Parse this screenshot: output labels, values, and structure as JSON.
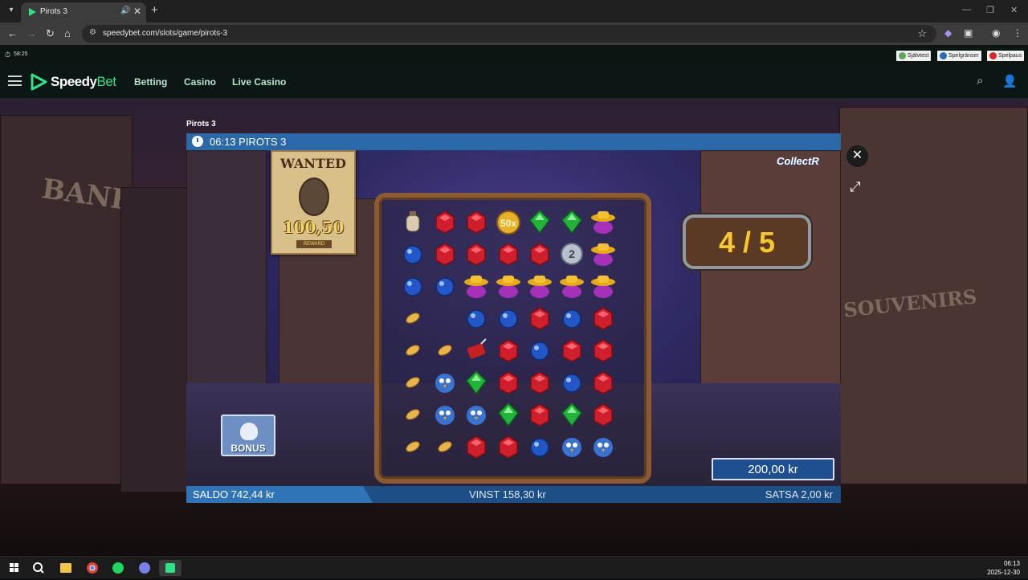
{
  "browser": {
    "tab_title": "Pirots 3",
    "url": "speedybet.com/slots/game/pirots-3",
    "icons": [
      "tab-list-icon",
      "audio-icon",
      "close-icon",
      "plus-icon",
      "back-icon",
      "forward-icon",
      "reload-icon",
      "home-icon",
      "site-info-icon",
      "star-icon",
      "extension-icon",
      "profile-icon",
      "menu-icon"
    ]
  },
  "site": {
    "session_timer": "58:25",
    "responsible_gaming": [
      "Självtest",
      "Spelgränser",
      "Spelpaus"
    ],
    "logo_part1": "Speedy",
    "logo_part2": "Bet",
    "nav": [
      "Betting",
      "Casino",
      "Live Casino"
    ],
    "accent_color": "#2fe28a"
  },
  "page": {
    "title": "Pirots 3"
  },
  "game": {
    "header": "06:13 PIROTS 3",
    "brand": "CollectR",
    "wanted_title": "WANTED",
    "wanted_value": "100,50",
    "wanted_reward": "REWARD",
    "counter": "4 / 5",
    "bonus_label": "BONUS",
    "bet_amount": "200,00 kr",
    "balance": "SALDO 742,44 kr",
    "win": "VINST 158,30 kr",
    "stake": "SATSA 2,00 kr",
    "multiplier_label": "50x",
    "coin_label": "2",
    "grid": [
      [
        "jug",
        "red",
        "red",
        "coin",
        "green",
        "green",
        "hat"
      ],
      [
        "blue",
        "red",
        "red",
        "red",
        "red",
        "silver",
        "hat"
      ],
      [
        "blue",
        "blue",
        "hat",
        "hat",
        "hat",
        "hat",
        "hat"
      ],
      [
        "nugget",
        "empty",
        "blue",
        "blue",
        "red",
        "blue",
        "red"
      ],
      [
        "nugget",
        "nugget",
        "dynamite",
        "red",
        "blue",
        "red",
        "red"
      ],
      [
        "nugget",
        "bird",
        "green",
        "red",
        "red",
        "blue",
        "red"
      ],
      [
        "nugget",
        "bird",
        "bird",
        "green",
        "red",
        "green",
        "red"
      ],
      [
        "nugget",
        "nugget",
        "red",
        "red",
        "blue",
        "bird",
        "bird"
      ]
    ]
  },
  "taskbar": {
    "time": "06:13",
    "date": "2025-12-30"
  }
}
